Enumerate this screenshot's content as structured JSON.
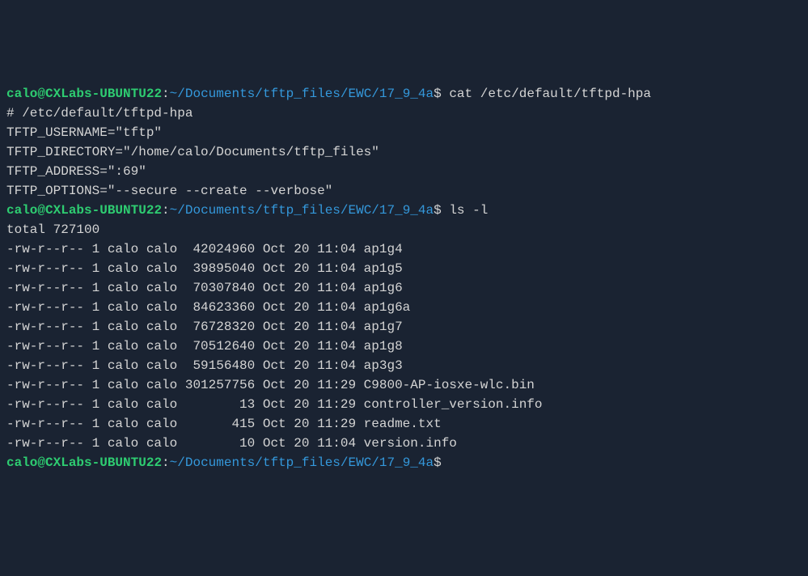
{
  "prompt": {
    "user": "calo",
    "at": "@",
    "host": "CXLabs-UBUNTU22",
    "colon": ":",
    "path": "~/Documents/tftp_files/EWC/17_9_4a",
    "dollar": "$"
  },
  "commands": {
    "cat": "cat /etc/default/tftpd-hpa",
    "ls": "ls -l"
  },
  "cat_output": {
    "comment": "# /etc/default/tftpd-hpa",
    "blank": "",
    "username": "TFTP_USERNAME=\"tftp\"",
    "directory": "TFTP_DIRECTORY=\"/home/calo/Documents/tftp_files\"",
    "address": "TFTP_ADDRESS=\":69\"",
    "options": "TFTP_OPTIONS=\"--secure --create --verbose\""
  },
  "ls_output": {
    "total": "total 727100",
    "rows": [
      {
        "perms": "-rw-r--r--",
        "links": "1",
        "owner": "calo",
        "group": "calo",
        "size": "42024960",
        "month": "Oct",
        "day": "20",
        "time": "11:04",
        "name": "ap1g4"
      },
      {
        "perms": "-rw-r--r--",
        "links": "1",
        "owner": "calo",
        "group": "calo",
        "size": "39895040",
        "month": "Oct",
        "day": "20",
        "time": "11:04",
        "name": "ap1g5"
      },
      {
        "perms": "-rw-r--r--",
        "links": "1",
        "owner": "calo",
        "group": "calo",
        "size": "70307840",
        "month": "Oct",
        "day": "20",
        "time": "11:04",
        "name": "ap1g6"
      },
      {
        "perms": "-rw-r--r--",
        "links": "1",
        "owner": "calo",
        "group": "calo",
        "size": "84623360",
        "month": "Oct",
        "day": "20",
        "time": "11:04",
        "name": "ap1g6a"
      },
      {
        "perms": "-rw-r--r--",
        "links": "1",
        "owner": "calo",
        "group": "calo",
        "size": "76728320",
        "month": "Oct",
        "day": "20",
        "time": "11:04",
        "name": "ap1g7"
      },
      {
        "perms": "-rw-r--r--",
        "links": "1",
        "owner": "calo",
        "group": "calo",
        "size": "70512640",
        "month": "Oct",
        "day": "20",
        "time": "11:04",
        "name": "ap1g8"
      },
      {
        "perms": "-rw-r--r--",
        "links": "1",
        "owner": "calo",
        "group": "calo",
        "size": "59156480",
        "month": "Oct",
        "day": "20",
        "time": "11:04",
        "name": "ap3g3"
      },
      {
        "perms": "-rw-r--r--",
        "links": "1",
        "owner": "calo",
        "group": "calo",
        "size": "301257756",
        "month": "Oct",
        "day": "20",
        "time": "11:29",
        "name": "C9800-AP-iosxe-wlc.bin"
      },
      {
        "perms": "-rw-r--r--",
        "links": "1",
        "owner": "calo",
        "group": "calo",
        "size": "13",
        "month": "Oct",
        "day": "20",
        "time": "11:29",
        "name": "controller_version.info"
      },
      {
        "perms": "-rw-r--r--",
        "links": "1",
        "owner": "calo",
        "group": "calo",
        "size": "415",
        "month": "Oct",
        "day": "20",
        "time": "11:29",
        "name": "readme.txt"
      },
      {
        "perms": "-rw-r--r--",
        "links": "1",
        "owner": "calo",
        "group": "calo",
        "size": "10",
        "month": "Oct",
        "day": "20",
        "time": "11:04",
        "name": "version.info"
      }
    ]
  }
}
